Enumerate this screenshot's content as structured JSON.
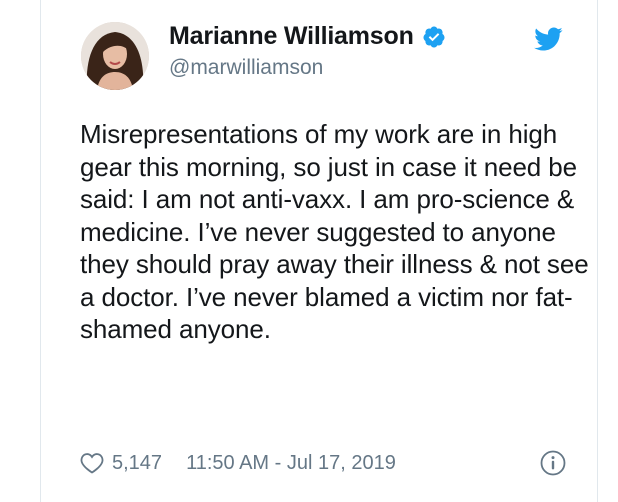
{
  "author": {
    "name": "Marianne Williamson",
    "handle": "@marwilliamson"
  },
  "tweet": {
    "text": "Misrepresentations of my work are in high gear this morning, so just in case it need be said: I am not anti-vaxx. I am pro-science & medicine. I’ve never suggested to anyone they should pray away their illness & not see a doctor. I’ve never blamed a victim nor fat-shamed anyone."
  },
  "meta": {
    "likes": "5,147",
    "timestamp": "11:50 AM - Jul 17, 2019"
  },
  "icons": {
    "verified": "verified-badge-icon",
    "bird": "twitter-bird-icon",
    "like": "heart-icon",
    "info": "info-icon"
  },
  "colors": {
    "brand_blue": "#1da1f2",
    "text_primary": "#14171a",
    "text_secondary": "#657786"
  }
}
